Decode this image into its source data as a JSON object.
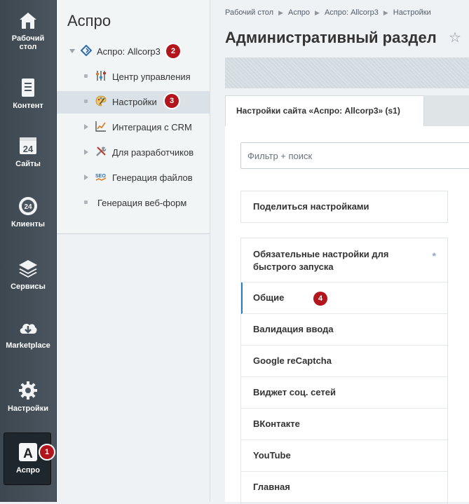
{
  "leftbar": {
    "items": [
      {
        "label_line1": "Рабочий",
        "label_line2": "стол",
        "icon": "home-icon"
      },
      {
        "label": "Контент",
        "icon": "document-icon"
      },
      {
        "label": "Сайты",
        "icon": "calendar-24-icon"
      },
      {
        "label": "Клиенты",
        "icon": "crm-24-icon"
      },
      {
        "label": "Сервисы",
        "icon": "layers-icon"
      },
      {
        "label": "Marketplace",
        "icon": "cloud-download-icon"
      },
      {
        "label": "Настройки",
        "icon": "gear-icon"
      },
      {
        "label": "Аспро",
        "icon": "aspro-a-icon",
        "active": true
      }
    ]
  },
  "badges": {
    "b1": "1",
    "b2": "2",
    "b3": "3",
    "b4": "4"
  },
  "tree": {
    "title": "Аспро",
    "root": "Аспро: Allcorp3",
    "items": [
      {
        "label": "Центр управления",
        "icon": "control-sliders-icon"
      },
      {
        "label": "Настройки",
        "icon": "palette-icon",
        "selected": true
      },
      {
        "label": "Интеграция с CRM",
        "icon": "chart-icon"
      },
      {
        "label": "Для разработчиков",
        "icon": "tools-icon"
      },
      {
        "label": "Генерация файлов",
        "icon": "seo-icon"
      },
      {
        "label": "Генерация веб-форм"
      }
    ]
  },
  "breadcrumbs": [
    "Рабочий стол",
    "Аспро",
    "Аспро: Allcorp3",
    "Настройки"
  ],
  "page_title": "Административный раздел",
  "tab_label": "Настройки сайта «Аспро: Allcorp3» (s1)",
  "filter": {
    "placeholder": "Фильтр + поиск"
  },
  "share_label": "Поделиться настройками",
  "menu": {
    "required_line1": "Обязательные настройки для",
    "required_line2": "быстрого запуска",
    "required_mark": "*",
    "items": [
      "Общие",
      "Валидация ввода",
      "Google reCaptcha",
      "Виджет соц. сетей",
      "ВКонтакте",
      "YouTube",
      "Главная"
    ]
  },
  "colors": {
    "sidebar": "#4b555f",
    "badge": "#b3151c",
    "accent": "#2b7bbf"
  }
}
